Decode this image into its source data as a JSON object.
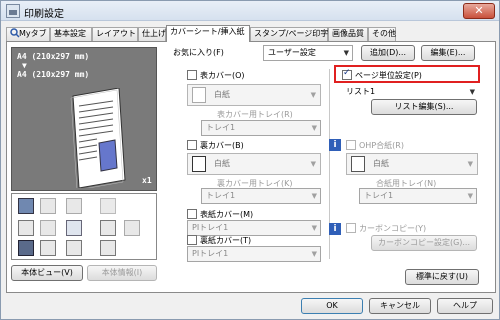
{
  "window": {
    "title": "印刷設定",
    "close": "✕"
  },
  "tabs": [
    {
      "label": "Myタブ"
    },
    {
      "label": "基本設定"
    },
    {
      "label": "レイアウト"
    },
    {
      "label": "仕上げ"
    },
    {
      "label": "カバーシート/挿入紙"
    },
    {
      "label": "スタンプ/ページ印字"
    },
    {
      "label": "画像品質"
    },
    {
      "label": "その他"
    }
  ],
  "preview": {
    "line1": "A4 (210x297 mm)",
    "arrow": "▼",
    "line2": "A4 (210x297 mm)",
    "copies": "x1"
  },
  "left_buttons": {
    "view": "本体ビュー(V)",
    "info": "本体情報(I)"
  },
  "favorites": {
    "label": "お気に入り(F)",
    "value": "ユーザー設定",
    "add": "追加(D)...",
    "edit": "編集(E)..."
  },
  "front_cover": {
    "label": "表カバー(O)",
    "paper": "白紙",
    "tray_label": "表カバー用トレイ(R)",
    "tray": "トレイ1"
  },
  "back_cover": {
    "label": "裏カバー(B)",
    "paper": "白紙",
    "tray_label": "裏カバー用トレイ(K)",
    "tray": "トレイ1"
  },
  "page_settings": {
    "label": "ページ単位設定(P)",
    "checked": true,
    "list_value": "リスト1",
    "list_edit": "リスト編集(S)..."
  },
  "ohp": {
    "label": "OHP合紙(R)",
    "paper": "白紙",
    "tray_label": "合紙用トレイ(N)",
    "tray": "トレイ1"
  },
  "pi_front": {
    "label": "表紙カバー(M)",
    "tray": "PIトレイ1"
  },
  "pi_back": {
    "label": "裏紙カバー(T)",
    "tray": "PIトレイ1"
  },
  "carbon": {
    "label": "カーボンコピー(Y)",
    "settings": "カーボンコピー設定(G)..."
  },
  "restore": "標準に戻す(U)",
  "footer": {
    "ok": "OK",
    "cancel": "キャンセル",
    "help": "ヘルプ"
  },
  "colors": {
    "accent_red": "#e02020",
    "info_blue": "#2f5fb8"
  }
}
